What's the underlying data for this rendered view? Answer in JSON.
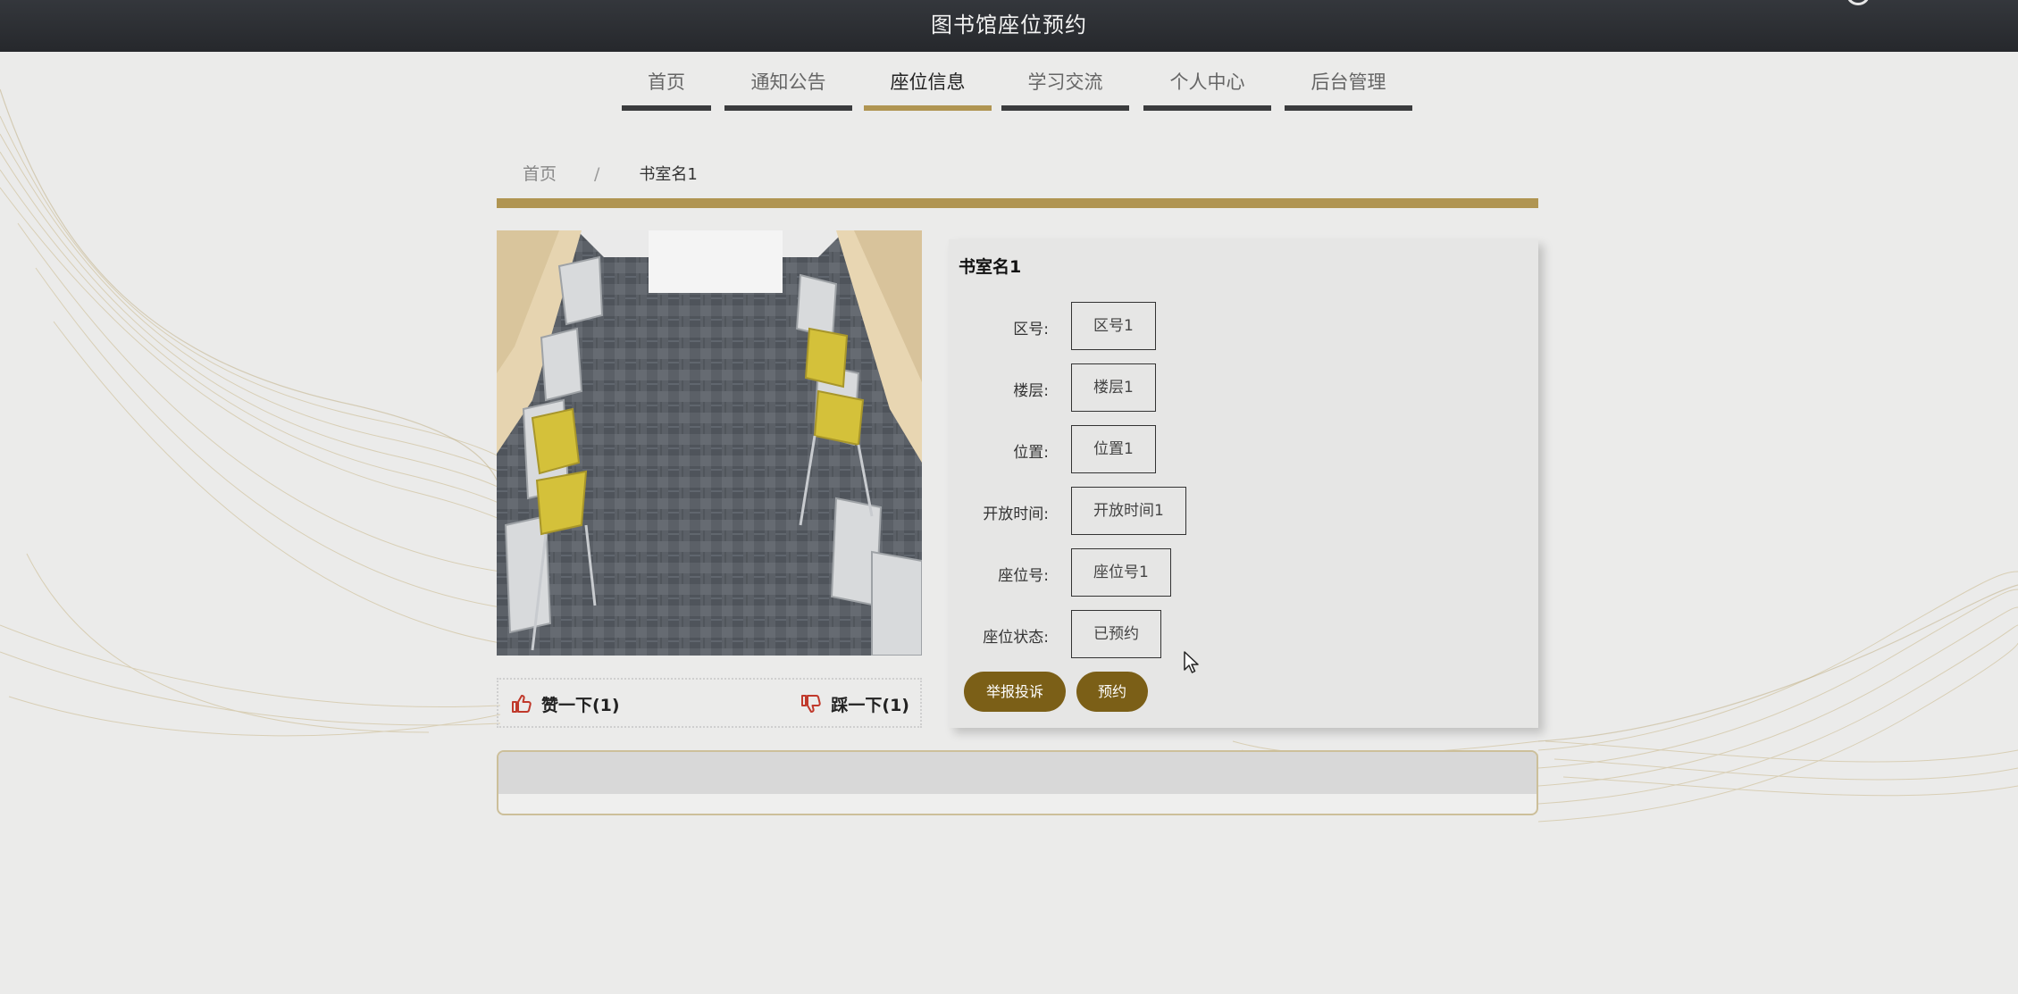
{
  "site": {
    "title": "图书馆座位预约"
  },
  "nav": {
    "items": [
      {
        "label": "首页",
        "active": false
      },
      {
        "label": "通知公告",
        "active": false
      },
      {
        "label": "座位信息",
        "active": true
      },
      {
        "label": "学习交流",
        "active": false
      },
      {
        "label": "个人中心",
        "active": false
      },
      {
        "label": "后台管理",
        "active": false
      }
    ]
  },
  "breadcrumb": {
    "home": "首页",
    "separator": "/",
    "current": "书室名1"
  },
  "votes": {
    "up_label": "赞一下(1)",
    "down_label": "踩一下(1)"
  },
  "detail": {
    "room_name": "书室名1",
    "fields": [
      {
        "label": "区号:",
        "value": "区号1"
      },
      {
        "label": "楼层:",
        "value": "楼层1"
      },
      {
        "label": "位置:",
        "value": "位置1"
      },
      {
        "label": "开放时间:",
        "value": "开放时间1"
      },
      {
        "label": "座位号:",
        "value": "座位号1"
      },
      {
        "label": "座位状态:",
        "value": "已预约"
      }
    ],
    "buttons": {
      "report": "举报投诉",
      "reserve": "预约"
    }
  },
  "colors": {
    "topbar": "#2b2d31",
    "accent_gold": "#b09552",
    "button_brown": "#7b5f17",
    "nav_underline": "#3a3b3d"
  },
  "icons": {
    "vote_up": "thumbs-up-icon",
    "vote_down": "thumbs-down-icon",
    "cursor": "mouse-cursor-icon"
  }
}
